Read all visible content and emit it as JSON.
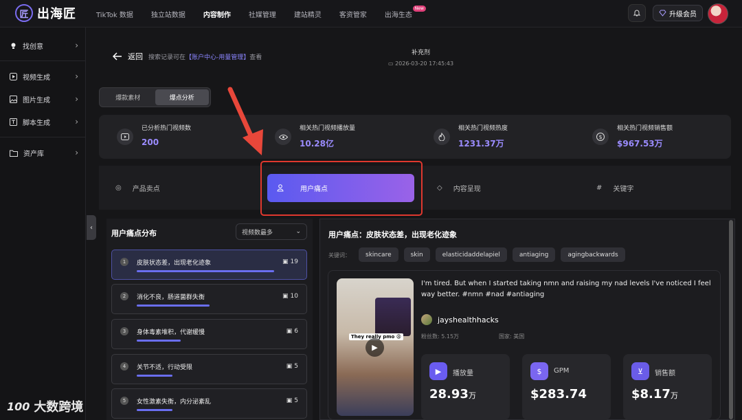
{
  "header": {
    "logo_text": "出海匠",
    "nav": [
      {
        "label": "TikTok 数据"
      },
      {
        "label": "独立站数据"
      },
      {
        "label": "内容制作"
      },
      {
        "label": "社媒管理"
      },
      {
        "label": "建站精灵"
      },
      {
        "label": "客资管家"
      },
      {
        "label": "出海生态"
      }
    ],
    "new_badge": "New",
    "upgrade_label": "升级会员"
  },
  "sidebar": {
    "items": [
      {
        "label": "找创意",
        "icon": "bulb-icon"
      },
      {
        "label": "视频生成",
        "icon": "video-icon"
      },
      {
        "label": "图片生成",
        "icon": "image-icon"
      },
      {
        "label": "脚本生成",
        "icon": "script-icon"
      },
      {
        "label": "资产库",
        "icon": "folder-icon"
      }
    ]
  },
  "page": {
    "back_label": "返回",
    "note_prefix": "搜索记录可在",
    "note_link": "【账户中心-用量管理】",
    "note_suffix": "查看",
    "title": "补充剂",
    "date": "2026-03-20 17:45:43",
    "tabs": [
      "爆款素材",
      "爆点分析"
    ]
  },
  "stats": [
    {
      "label": "已分析热门视频数",
      "value": "200",
      "icon": "video-icon"
    },
    {
      "label": "相关热门视频播放量",
      "value": "10.28亿",
      "icon": "eye-icon"
    },
    {
      "label": "相关热门视频热度",
      "value": "1231.37万",
      "icon": "fire-icon"
    },
    {
      "label": "相关热门视频销售额",
      "value": "$967.53万",
      "icon": "dollar-icon"
    }
  ],
  "filters": [
    {
      "label": "产品卖点",
      "icon": "bulb-icon"
    },
    {
      "label": "用户痛点",
      "icon": "user-icon"
    },
    {
      "label": "内容呈现",
      "icon": "tag-icon"
    },
    {
      "label": "关键字",
      "icon": "hash-icon"
    }
  ],
  "pain_panel": {
    "title": "用户痛点分布",
    "sort_label": "视频数最多",
    "items": [
      {
        "num": "1",
        "text": "皮肤状态差，出现老化迹象",
        "count": "19",
        "fill": 1.0
      },
      {
        "num": "2",
        "text": "消化不良，肠道菌群失衡",
        "count": "10",
        "fill": 0.53
      },
      {
        "num": "3",
        "text": "身体毒素堆积，代谢缓慢",
        "count": "6",
        "fill": 0.32
      },
      {
        "num": "4",
        "text": "关节不适，行动受限",
        "count": "5",
        "fill": 0.26
      },
      {
        "num": "5",
        "text": "女性激素失衡，内分泌紊乱",
        "count": "5",
        "fill": 0.26
      }
    ]
  },
  "detail": {
    "title": "用户痛点：皮肤状态差，出现老化迹象",
    "kw_label": "关键词：",
    "keywords": [
      "skincare",
      "skin",
      "elasticidaddelapiel",
      "antiaging",
      "agingbackwards"
    ],
    "description": "I'm tired. But when I started taking nmn and raising my nad levels I've noticed I feel way better. #nmn #nad #antiaging",
    "thumb_caption": "They really pmo 😩",
    "author": "jayshealthhacks",
    "fans": "粉丝数: 5.15万",
    "country": "国家: 美国",
    "metrics": [
      {
        "label": "播放量",
        "value": "28.93",
        "unit": "万",
        "icon": "play-icon",
        "color": "#6a5cf0"
      },
      {
        "label": "GPM",
        "value": "$283.74",
        "unit": "",
        "icon": "money-icon",
        "color": "#7a66f0"
      },
      {
        "label": "销售额",
        "value": "$8.17",
        "unit": "万",
        "icon": "cart-icon",
        "color": "#6a5ce8"
      }
    ]
  },
  "watermark": {
    "text": "大数跨境",
    "mark": "100"
  }
}
